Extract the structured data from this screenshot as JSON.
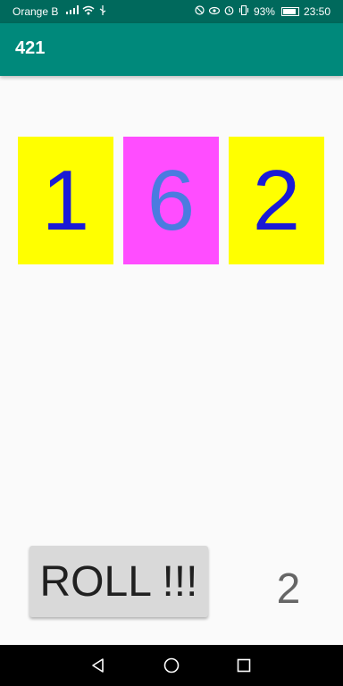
{
  "status_bar": {
    "carrier": "Orange B",
    "battery": "93%",
    "time": "23:50"
  },
  "app_bar": {
    "title": "421"
  },
  "dice": [
    {
      "value": "1",
      "background": "#ffff00",
      "text_color": "#1a1ad6"
    },
    {
      "value": "6",
      "background": "#ff4dff",
      "text_color": "#4b7be0"
    },
    {
      "value": "2",
      "background": "#ffff00",
      "text_color": "#1a1ad6"
    }
  ],
  "roll_button": {
    "label": "ROLL !!!"
  },
  "roll_counter": "2",
  "colors": {
    "status_bar": "#00695c",
    "app_bar": "#00897b",
    "background": "#fafafa"
  }
}
